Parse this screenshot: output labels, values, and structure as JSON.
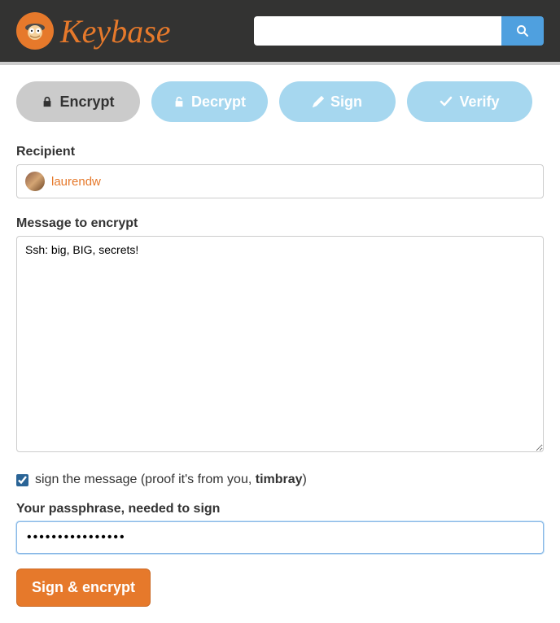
{
  "header": {
    "brand": "Keybase",
    "search_value": ""
  },
  "tabs": {
    "encrypt": "Encrypt",
    "decrypt": "Decrypt",
    "sign": "Sign",
    "verify": "Verify"
  },
  "recipient": {
    "label": "Recipient",
    "name": "laurendw"
  },
  "message": {
    "label": "Message to encrypt",
    "value": "Ssh: big, BIG, secrets!"
  },
  "sign_option": {
    "checked": true,
    "text_before": "sign the message (proof it's from you, ",
    "username": "timbray",
    "text_after": ")"
  },
  "passphrase": {
    "label": "Your passphrase, needed to sign",
    "value": "••••••••••••••••"
  },
  "submit": "Sign & encrypt"
}
